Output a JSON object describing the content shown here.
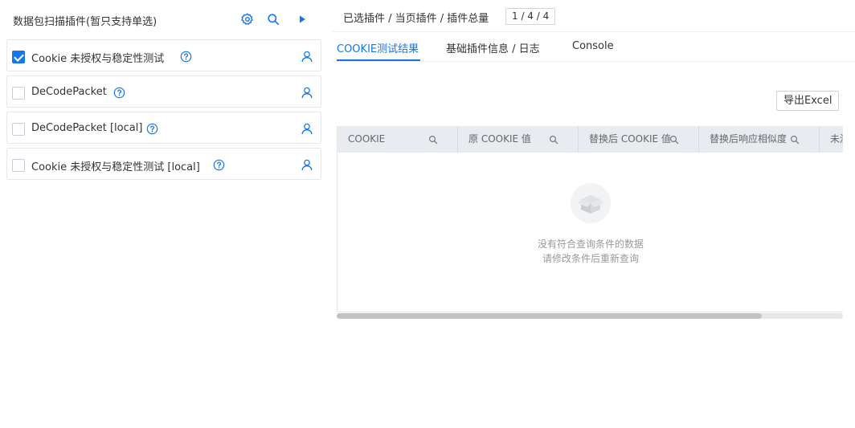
{
  "left_panel": {
    "title": "数据包扫描插件(暂只支持单选)",
    "icons": {
      "settings": "gear-icon",
      "search": "search-icon",
      "run": "play-icon"
    },
    "plugins": [
      {
        "name": "Cookie 未授权与稳定性测试",
        "checked": true
      },
      {
        "name": "DeCodePacket",
        "checked": false
      },
      {
        "name": "DeCodePacket [local]",
        "checked": false
      },
      {
        "name": "Cookie 未授权与稳定性测试 [local]",
        "checked": false
      }
    ]
  },
  "right_panel": {
    "stats_label": "已选插件 / 当页插件 / 插件总量",
    "stats_value": "1 / 4 / 4",
    "tabs": [
      {
        "label": "COOKIE测试结果",
        "active": true
      },
      {
        "label": "基础插件信息 / 日志",
        "active": false
      },
      {
        "label": "Console",
        "active": false
      }
    ],
    "export_label": "导出Excel",
    "table": {
      "columns": [
        "COOKIE",
        "原 COOKIE 值",
        "替换后 COOKIE 值",
        "替换后响应相似度",
        "未测"
      ],
      "empty_line1": "没有符合查询条件的数据",
      "empty_line2": "请修改条件后重新查询"
    }
  },
  "colors": {
    "accent": "#1677e8",
    "header_bg": "#e8ecf1"
  }
}
